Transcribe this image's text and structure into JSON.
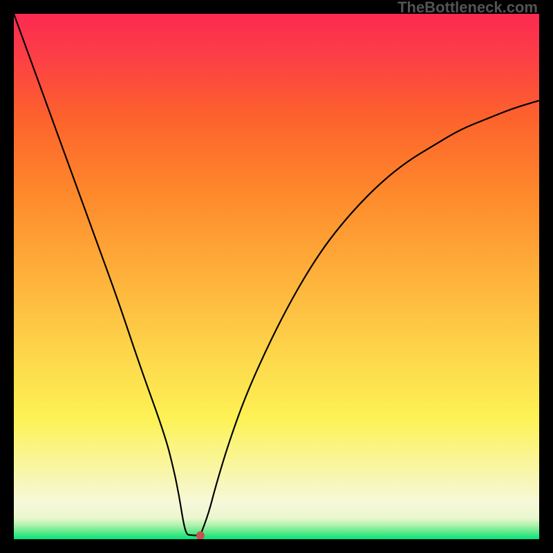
{
  "watermark": "TheBottleneck.com",
  "chart_data": {
    "type": "line",
    "title": "",
    "xlabel": "",
    "ylabel": "",
    "xlim": [
      0,
      100
    ],
    "ylim": [
      0,
      100
    ],
    "x_marker": 35,
    "left_branch": [
      {
        "x": 0,
        "y": 100
      },
      {
        "x": 4,
        "y": 89
      },
      {
        "x": 8,
        "y": 78
      },
      {
        "x": 12,
        "y": 67
      },
      {
        "x": 16,
        "y": 56
      },
      {
        "x": 20,
        "y": 45
      },
      {
        "x": 24,
        "y": 33
      },
      {
        "x": 28.8,
        "y": 19.7
      },
      {
        "x": 30.5,
        "y": 13
      },
      {
        "x": 31.5,
        "y": 8
      },
      {
        "x": 32.3,
        "y": 3
      },
      {
        "x": 32.9,
        "y": 0.9
      },
      {
        "x": 33.5,
        "y": 0.8
      },
      {
        "x": 34.5,
        "y": 0.7
      },
      {
        "x": 35.5,
        "y": 0.7
      }
    ],
    "right_branch": [
      {
        "x": 35.5,
        "y": 0.7
      },
      {
        "x": 37.1,
        "y": 5
      },
      {
        "x": 38.4,
        "y": 10
      },
      {
        "x": 40.8,
        "y": 18
      },
      {
        "x": 44,
        "y": 27
      },
      {
        "x": 48,
        "y": 36
      },
      {
        "x": 52,
        "y": 44
      },
      {
        "x": 56,
        "y": 51
      },
      {
        "x": 60,
        "y": 57
      },
      {
        "x": 65,
        "y": 63
      },
      {
        "x": 70,
        "y": 68
      },
      {
        "x": 75,
        "y": 72
      },
      {
        "x": 80,
        "y": 75
      },
      {
        "x": 85,
        "y": 78
      },
      {
        "x": 90,
        "y": 80
      },
      {
        "x": 95,
        "y": 82
      },
      {
        "x": 100,
        "y": 83.5
      }
    ],
    "marker_radius": 6,
    "marker_color": "#ca4f4c",
    "line_color": "#000000",
    "line_width": 2.2
  }
}
